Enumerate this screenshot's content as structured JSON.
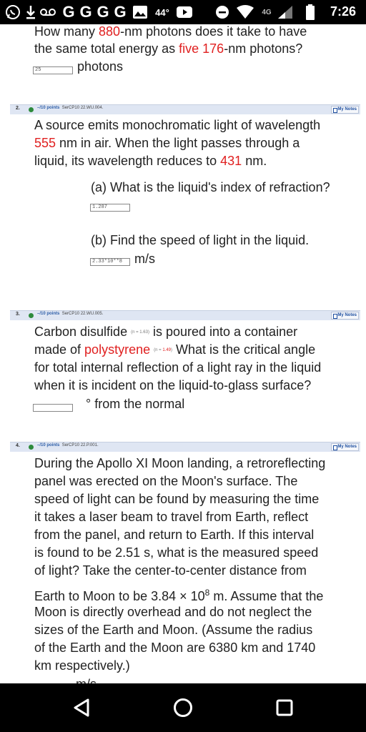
{
  "status_bar": {
    "time": "7:26",
    "battery_level": "44°",
    "network": "4G",
    "icons": [
      "whatsapp-icon",
      "download-icon",
      "voicemail-icon",
      "google-icon",
      "google-icon",
      "google-icon",
      "google-icon",
      "image-icon",
      "youtube-icon",
      "record-icon",
      "wifi-icon",
      "signal-icon",
      "battery-icon"
    ],
    "google_letter": "G"
  },
  "q1": {
    "line1_pre": "How many ",
    "line1_red": "880",
    "line1_post": "-nm photons does it take to have",
    "line2_pre": "the same total energy as ",
    "line2_red1": "five",
    "line2_mid": " ",
    "line2_red2": "176",
    "line2_post": "-nm photons?",
    "answer_value": "25",
    "unit": "photons"
  },
  "q2": {
    "number": "2.",
    "points": "–/10 points",
    "code": "SerCP10 22.WU.004.",
    "my_notes": "My Notes",
    "line1": "A source emits monochromatic light of wavelength",
    "line2_red": "555",
    "line2_post": " nm in air. When the light passes through a",
    "line3_pre": "liquid, its wavelength reduces to ",
    "line3_red": "431",
    "line3_post": " nm.",
    "part_a": "(a) What is the liquid's index of refraction?",
    "answer_a": "1.287",
    "part_b": "(b) Find the speed of light in the liquid.",
    "answer_b": "2.33*10**8",
    "unit_b": "m/s"
  },
  "q3": {
    "number": "3.",
    "points": "–/10 points",
    "code": "SerCP10 22.WU.005.",
    "my_notes": "My Notes",
    "line1_pre": "Carbon disulfide ",
    "line1_small": "(n = 1.63)",
    "line1_post": " is poured into a container",
    "line2_pre": "made of ",
    "line2_red": "polystyrene",
    "line2_small_pre": "(n = ",
    "line2_small_red": "1.49",
    "line2_small_post": ")",
    "line2_post": " What is the critical angle",
    "line3": "for total internal reflection of a light ray in the liquid",
    "line4": "when it is incident on the liquid-to-glass surface?",
    "answer_value": "",
    "unit": "° from the normal"
  },
  "q4": {
    "number": "4.",
    "points": "–/10 points",
    "code": "SerCP10 22.P.001.",
    "my_notes": "My Notes",
    "lines": [
      "During the Apollo XI Moon landing, a retroreflecting",
      "panel was erected on the Moon's surface. The",
      "speed of light can be found by measuring the time",
      "it takes a laser beam to travel from Earth, reflect",
      "from the panel, and return to Earth. If this interval",
      "is found to be 2.51 s, what is the measured speed",
      "of light? Take the center-to-center distance from"
    ],
    "line8_pre": "Earth to Moon to be 3.84 × 10",
    "line8_sup": "8",
    "line8_post": " m. Assume that the",
    "lines2": [
      "Moon is directly overhead and do not neglect the",
      "sizes of the Earth and Moon. (Assume the radius",
      "of the Earth and the Moon are 6380 km and 1740",
      "km respectively.)"
    ],
    "unit_partial": "m/s"
  },
  "nav": {
    "icons": [
      "back-icon",
      "home-icon",
      "recents-icon"
    ]
  }
}
